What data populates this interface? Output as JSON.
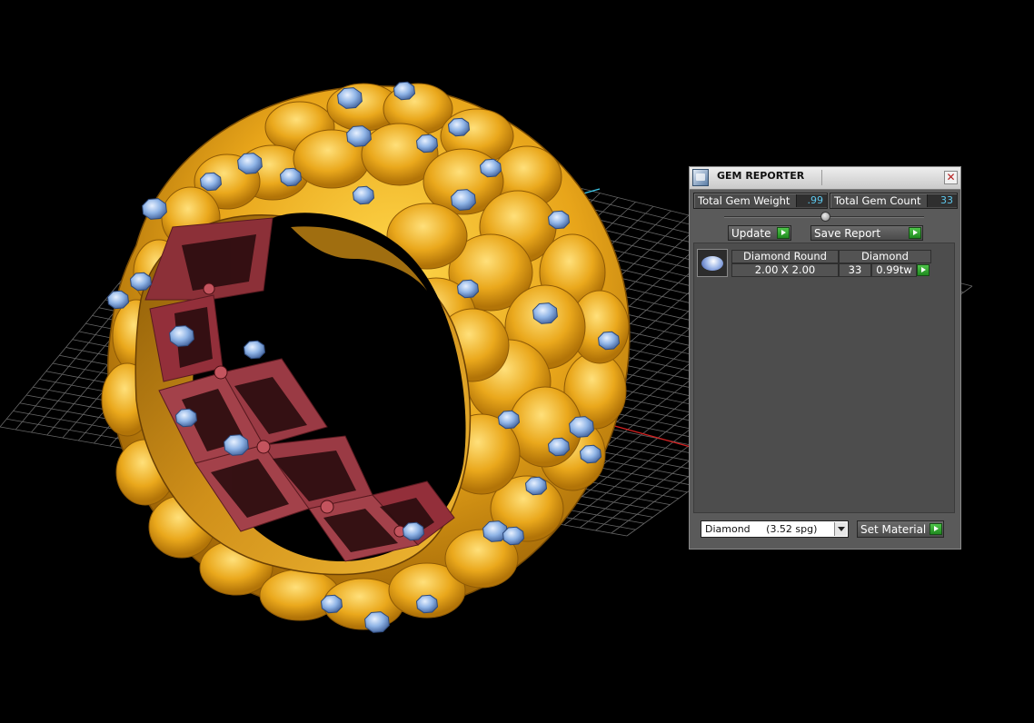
{
  "window": {
    "title": "GEM REPORTER",
    "close_glyph": "✕"
  },
  "stats": {
    "total_weight_label": "Total Gem Weight",
    "total_weight_value": ".99",
    "total_count_label": "Total Gem Count",
    "total_count_value": "33"
  },
  "actions": {
    "update_label": "Update",
    "save_report_label": "Save Report",
    "set_material_label": "Set Material"
  },
  "gem_list": {
    "items": [
      {
        "shape": "Diamond Round",
        "material": "Diamond",
        "size": "2.00 X 2.00",
        "count": "33",
        "weight": "0.99tw"
      }
    ]
  },
  "material_select": {
    "selected": "Diamond     (3.52 spg)"
  },
  "colors": {
    "panel_bg": "#5a5a5a",
    "value_text": "#5ec8ee",
    "go_button": "#2fa52b",
    "ring_gold": "#e8a51a",
    "gem_blue": "#8fb4e6",
    "inner_gallery": "#a3414a",
    "grid_line": "#8a8a8a",
    "axis_red": "#d22020",
    "axis_cyan": "#3ec8e8"
  },
  "icons": [
    "gem-reporter-app-icon",
    "close-icon",
    "divider-knob-icon",
    "go-arrow-icon",
    "gem-thumbnail-icon",
    "dropdown-arrow-icon"
  ]
}
